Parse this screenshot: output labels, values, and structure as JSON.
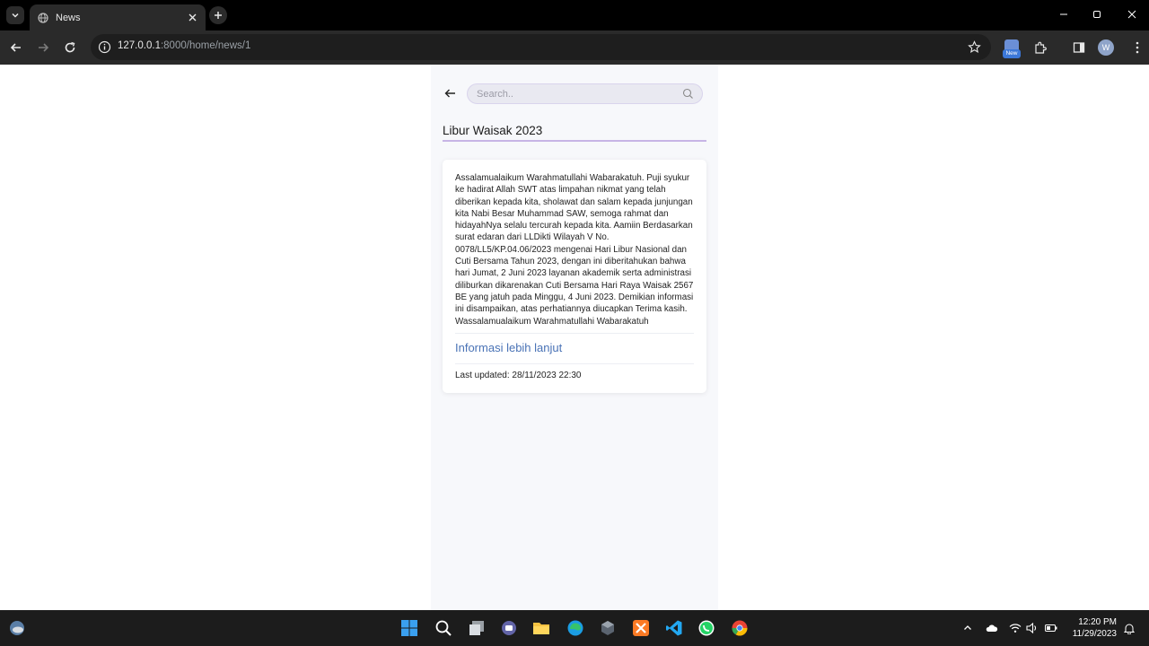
{
  "browser": {
    "tab_title": "News",
    "url_host": "127.0.0.1",
    "url_path": ":8000/home/news/1",
    "new_badge_label": "New",
    "profile_initial": "W"
  },
  "page": {
    "search_placeholder": "Search..",
    "title": "Libur Waisak 2023",
    "body": "Assalamualaikum Warahmatullahi Wabarakatuh. Puji syukur ke hadirat Allah SWT atas limpahan nikmat yang telah diberikan kepada kita, sholawat dan salam kepada junjungan kita Nabi Besar Muhammad SAW, semoga rahmat dan hidayahNya selalu tercurah kepada kita. Aamiin Berdasarkan surat edaran dari LLDikti Wilayah V No. 0078/LL5/KP.04.06/2023 mengenai Hari Libur Nasional dan Cuti Bersama Tahun 2023, dengan ini diberitahukan bahwa hari Jumat, 2 Juni 2023 layanan akademik serta administrasi diliburkan dikarenakan Cuti Bersama Hari Raya Waisak 2567 BE yang jatuh pada Minggu, 4 Juni 2023. Demikian informasi ini disampaikan, atas perhatiannya diucapkan Terima kasih. Wassalamualaikum Warahmatullahi Wabarakatuh",
    "more_link": "Informasi lebih lanjut",
    "last_updated": "Last updated: 28/11/2023 22:30"
  },
  "taskbar": {
    "time": "12:20 PM",
    "date": "11/29/2023"
  },
  "colors": {
    "accent": "#4a73b6",
    "title_rule": "#c7b5e6",
    "app_bg": "#f7f8fb"
  }
}
